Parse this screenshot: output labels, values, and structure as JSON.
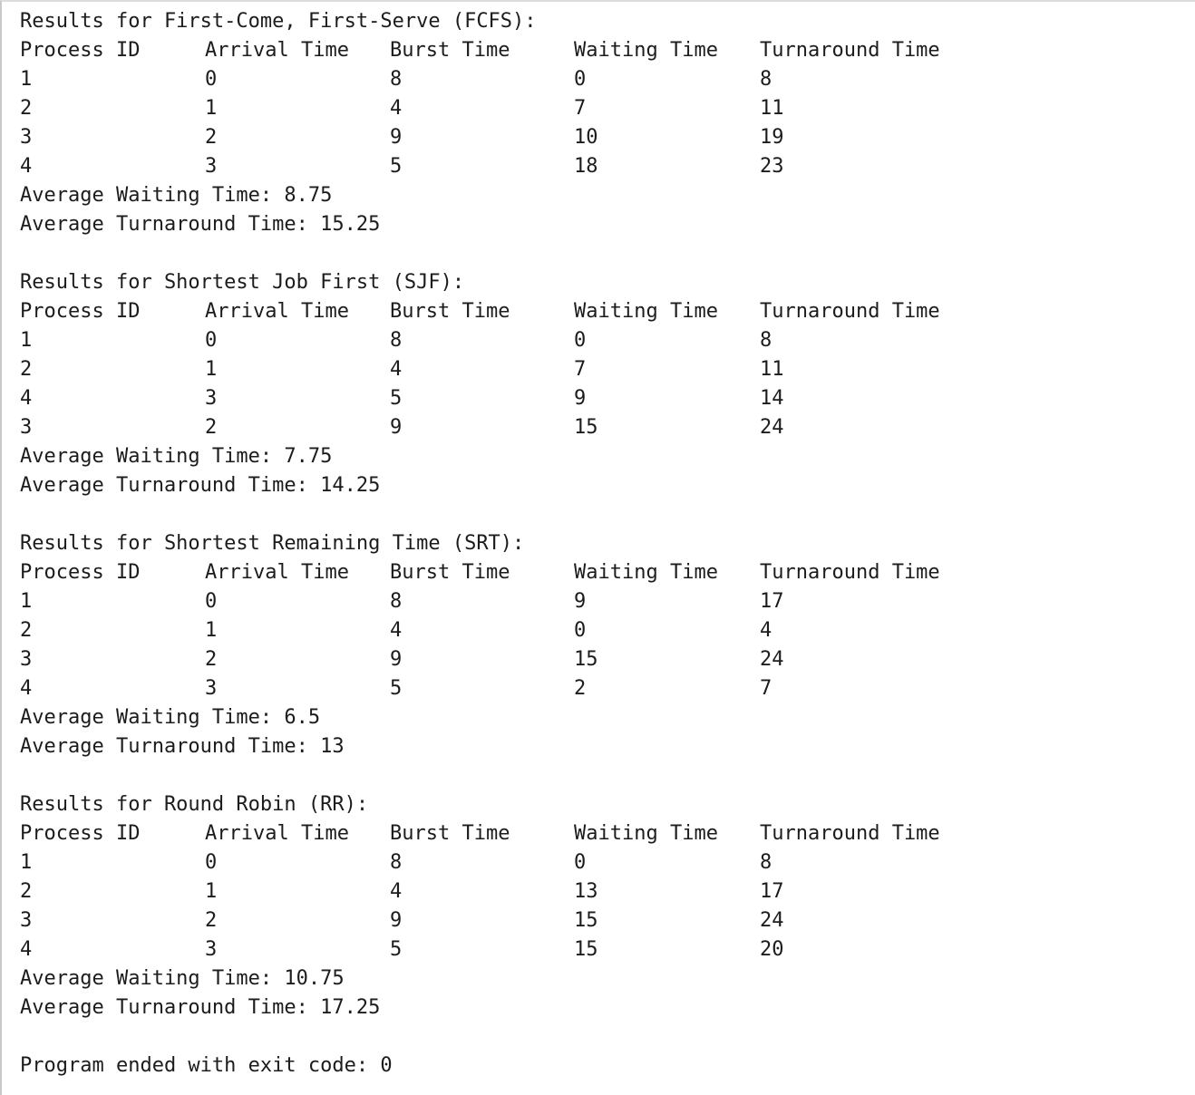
{
  "headers": [
    "Process ID",
    "Arrival Time",
    "Burst Time",
    "Waiting Time",
    "Turnaround Time"
  ],
  "avg_wait_label": "Average Waiting Time: ",
  "avg_turn_label": "Average Turnaround Time: ",
  "sections": [
    {
      "title": "Results for First-Come, First-Serve (FCFS):",
      "rows": [
        [
          "1",
          "0",
          "8",
          "0",
          "8"
        ],
        [
          "2",
          "1",
          "4",
          "7",
          "11"
        ],
        [
          "3",
          "2",
          "9",
          "10",
          "19"
        ],
        [
          "4",
          "3",
          "5",
          "18",
          "23"
        ]
      ],
      "avg_waiting": "8.75",
      "avg_turnaround": "15.25"
    },
    {
      "title": "Results for Shortest Job First (SJF):",
      "rows": [
        [
          "1",
          "0",
          "8",
          "0",
          "8"
        ],
        [
          "2",
          "1",
          "4",
          "7",
          "11"
        ],
        [
          "4",
          "3",
          "5",
          "9",
          "14"
        ],
        [
          "3",
          "2",
          "9",
          "15",
          "24"
        ]
      ],
      "avg_waiting": "7.75",
      "avg_turnaround": "14.25"
    },
    {
      "title": "Results for Shortest Remaining Time (SRT):",
      "rows": [
        [
          "1",
          "0",
          "8",
          "9",
          "17"
        ],
        [
          "2",
          "1",
          "4",
          "0",
          "4"
        ],
        [
          "3",
          "2",
          "9",
          "15",
          "24"
        ],
        [
          "4",
          "3",
          "5",
          "2",
          "7"
        ]
      ],
      "avg_waiting": "6.5",
      "avg_turnaround": "13"
    },
    {
      "title": "Results for Round Robin (RR):",
      "rows": [
        [
          "1",
          "0",
          "8",
          "0",
          "8"
        ],
        [
          "2",
          "1",
          "4",
          "13",
          "17"
        ],
        [
          "3",
          "2",
          "9",
          "15",
          "24"
        ],
        [
          "4",
          "3",
          "5",
          "15",
          "20"
        ]
      ],
      "avg_waiting": "10.75",
      "avg_turnaround": "17.25"
    }
  ],
  "exit_message": "Program ended with exit code: 0"
}
